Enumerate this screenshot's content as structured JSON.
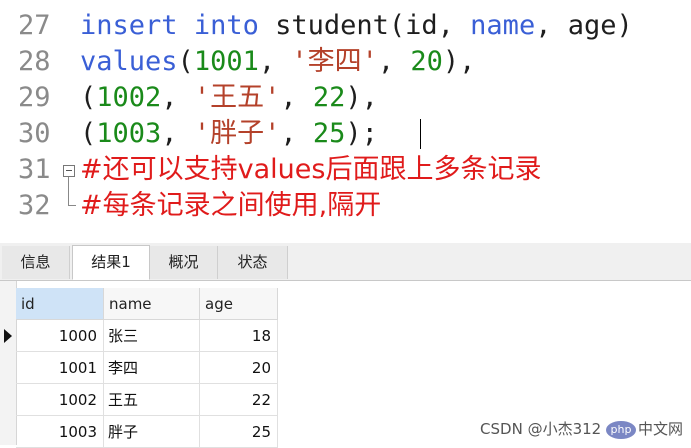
{
  "editor": {
    "lines": [
      {
        "no": "27",
        "tokens": [
          {
            "t": "insert",
            "c": "kw"
          },
          {
            "t": " ",
            "c": ""
          },
          {
            "t": "into",
            "c": "kw"
          },
          {
            "t": " student(id, ",
            "c": ""
          },
          {
            "t": "name",
            "c": "kw"
          },
          {
            "t": ", age)",
            "c": ""
          }
        ]
      },
      {
        "no": "28",
        "tokens": [
          {
            "t": "values",
            "c": "kw"
          },
          {
            "t": "(",
            "c": ""
          },
          {
            "t": "1001",
            "c": "num"
          },
          {
            "t": ", ",
            "c": ""
          },
          {
            "t": "'李四'",
            "c": "str"
          },
          {
            "t": ", ",
            "c": ""
          },
          {
            "t": "20",
            "c": "num"
          },
          {
            "t": "),",
            "c": ""
          }
        ]
      },
      {
        "no": "29",
        "tokens": [
          {
            "t": "(",
            "c": ""
          },
          {
            "t": "1002",
            "c": "num"
          },
          {
            "t": ", ",
            "c": ""
          },
          {
            "t": "'王五'",
            "c": "str"
          },
          {
            "t": ", ",
            "c": ""
          },
          {
            "t": "22",
            "c": "num"
          },
          {
            "t": "),",
            "c": ""
          }
        ]
      },
      {
        "no": "30",
        "tokens": [
          {
            "t": "(",
            "c": ""
          },
          {
            "t": "1003",
            "c": "num"
          },
          {
            "t": ", ",
            "c": ""
          },
          {
            "t": "'胖子'",
            "c": "str"
          },
          {
            "t": ", ",
            "c": ""
          },
          {
            "t": "25",
            "c": "num"
          },
          {
            "t": ");",
            "c": ""
          }
        ]
      },
      {
        "no": "31",
        "tokens": [
          {
            "t": "#还可以支持values后面跟上多条记录",
            "c": "cmt"
          }
        ]
      },
      {
        "no": "32",
        "tokens": [
          {
            "t": "#每条记录之间使用,隔开",
            "c": "cmt"
          }
        ]
      }
    ]
  },
  "tabs": [
    {
      "label": "信息",
      "active": false
    },
    {
      "label": "结果1",
      "active": true
    },
    {
      "label": "概况",
      "active": false
    },
    {
      "label": "状态",
      "active": false
    }
  ],
  "result": {
    "columns": [
      "id",
      "name",
      "age"
    ],
    "rows": [
      [
        "1000",
        "张三",
        "18"
      ],
      [
        "1001",
        "李四",
        "20"
      ],
      [
        "1002",
        "王五",
        "22"
      ],
      [
        "1003",
        "胖子",
        "25"
      ]
    ]
  },
  "watermark": {
    "logo": "php",
    "text": "中文网",
    "author": "CSDN @小杰312"
  },
  "colors": {
    "keyword": "#3a5fd6",
    "number": "#1a8a1a",
    "string": "#b4412a",
    "comment": "#e01b1b",
    "selected_header": "#cfe3f7"
  }
}
